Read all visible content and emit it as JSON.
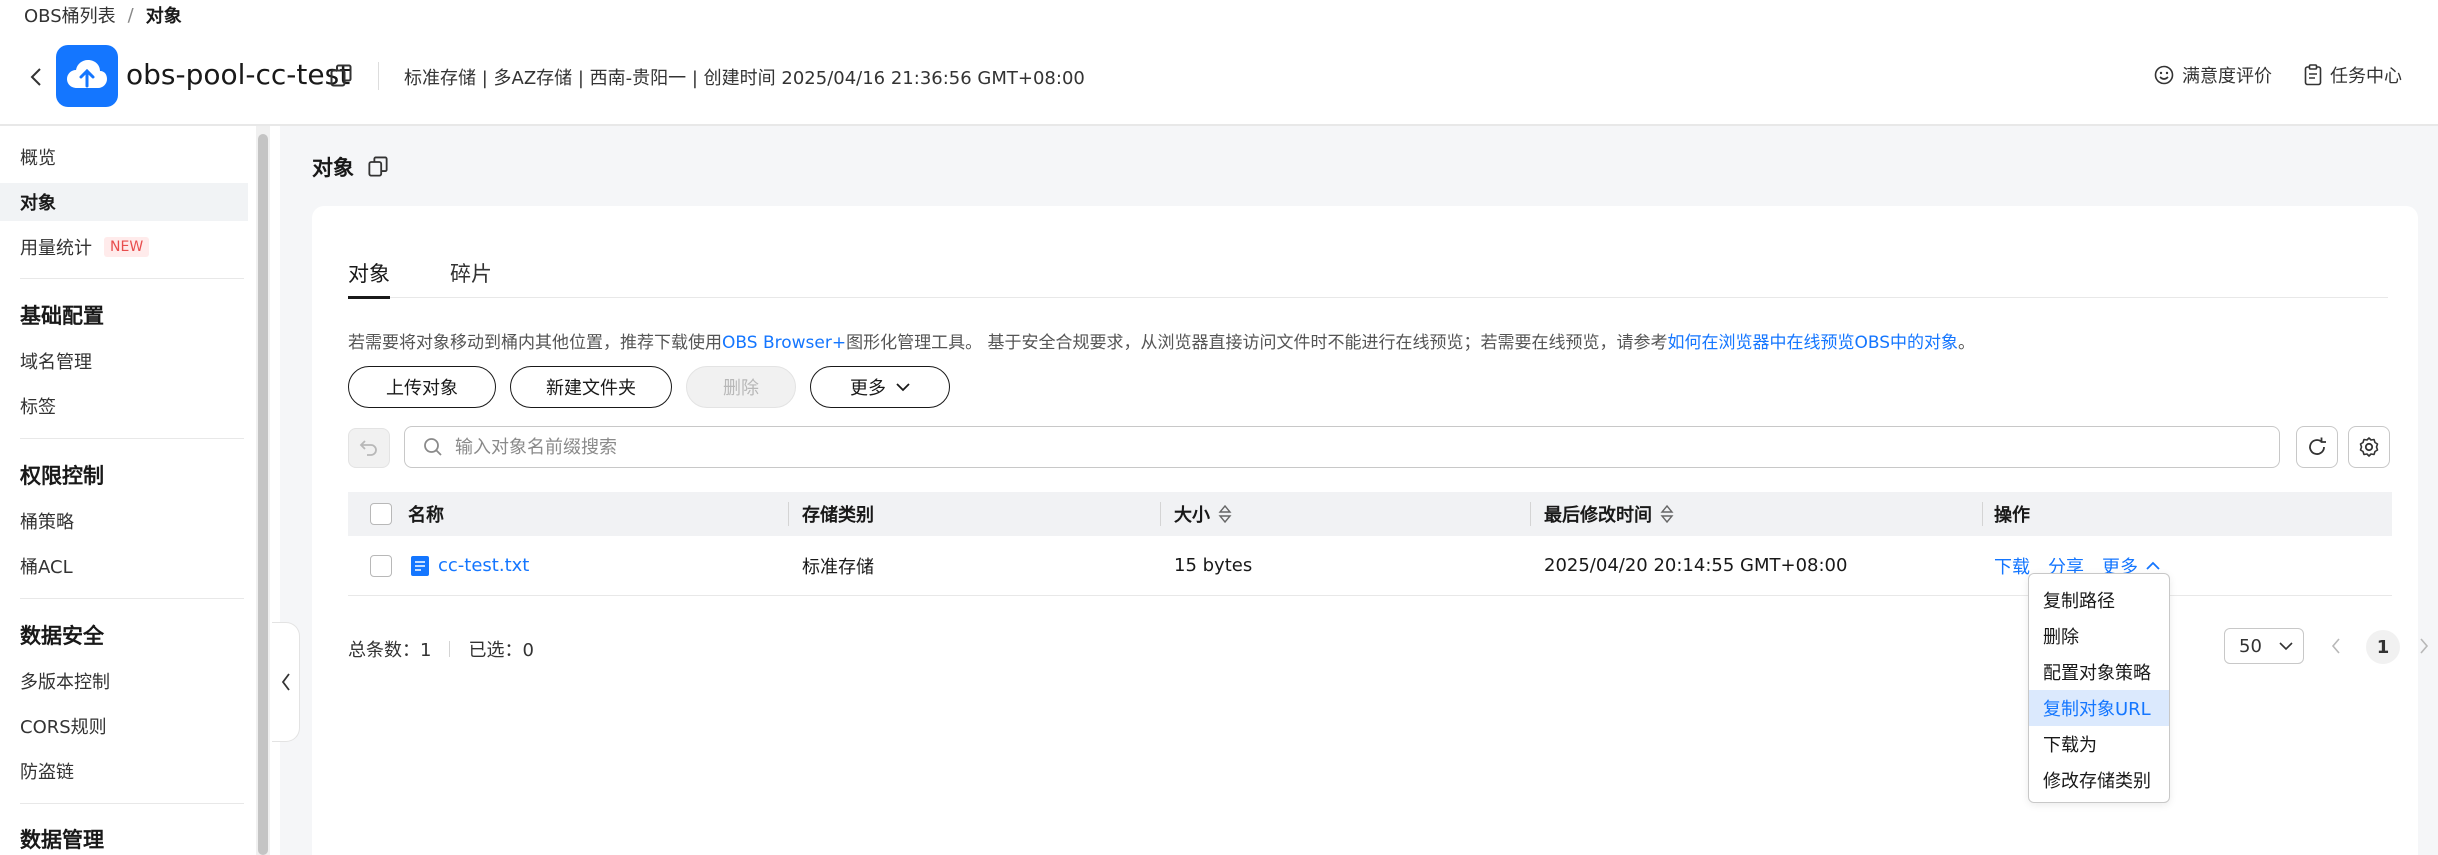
{
  "breadcrumb": {
    "parent": "OBS桶列表",
    "separator": "/",
    "current": "对象"
  },
  "bucket": {
    "name": "obs-pool-cc-test",
    "meta": "标准存储 | 多AZ存储 | 西南-贵阳一 | 创建时间  2025/04/16 21:36:56 GMT+08:00"
  },
  "header_actions": {
    "satisfaction": "满意度评价",
    "task_center": "任务中心"
  },
  "sidebar": {
    "items_top": [
      {
        "label": "概览"
      },
      {
        "label": "对象",
        "active": true
      },
      {
        "label": "用量统计",
        "badge": "NEW"
      }
    ],
    "groups": [
      {
        "title": "基础配置",
        "items": [
          "域名管理",
          "标签"
        ]
      },
      {
        "title": "权限控制",
        "items": [
          "桶策略",
          "桶ACL"
        ]
      },
      {
        "title": "数据安全",
        "items": [
          "多版本控制",
          "CORS规则",
          "防盗链"
        ]
      },
      {
        "title": "数据管理",
        "items": []
      }
    ]
  },
  "page_title": "对象",
  "tabs": [
    {
      "label": "对象",
      "active": true
    },
    {
      "label": "碎片"
    }
  ],
  "tip": {
    "text1": "若需要将对象移动到桶内其他位置，推荐下载使用",
    "link1": "OBS Browser+",
    "text2": "图形化管理工具。 基于安全合规要求，从浏览器直接访问文件时不能进行在线预览；若需要在线预览，请参考",
    "link2": "如何在浏览器中在线预览OBS中的对象",
    "text3": "。"
  },
  "buttons": {
    "upload": "上传对象",
    "new_folder": "新建文件夹",
    "delete": "删除",
    "more": "更多"
  },
  "search": {
    "placeholder": "输入对象名前缀搜索",
    "value": ""
  },
  "table": {
    "columns": {
      "name": "名称",
      "storage_class": "存储类别",
      "size": "大小",
      "modified": "最后修改时间",
      "ops": "操作"
    },
    "rows": [
      {
        "name": "cc-test.txt",
        "storage_class": "标准存储",
        "size": "15 bytes",
        "modified": "2025/04/20 20:14:55 GMT+08:00",
        "ops": {
          "download": "下载",
          "share": "分享",
          "more": "更多"
        }
      }
    ]
  },
  "footer": {
    "total_label": "总条数：",
    "total": "1",
    "selected_label": "已选：",
    "selected": "0",
    "page_size": "50",
    "page": "1"
  },
  "more_menu": {
    "items": [
      "复制路径",
      "删除",
      "配置对象策略",
      "复制对象URL",
      "下载为",
      "修改存储类别"
    ],
    "highlighted_index": 3
  },
  "colors": {
    "accent": "#1476ff",
    "hover_bg": "#dbe9fd",
    "new_badge": "#e84e4e"
  }
}
